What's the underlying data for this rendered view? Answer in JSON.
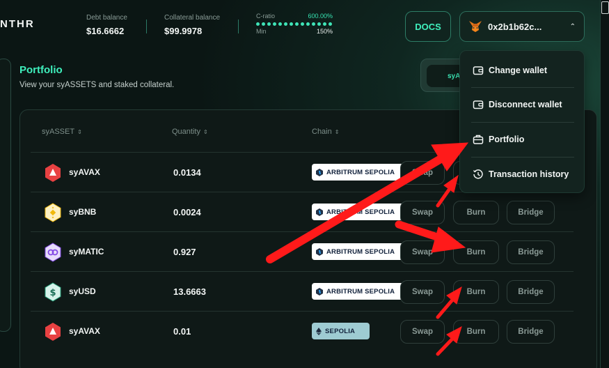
{
  "header": {
    "logo_text": "NTHR",
    "debt_label": "Debt balance",
    "debt_value": "$16.6662",
    "collateral_label": "Collateral balance",
    "collateral_value": "$99.9978",
    "cratio_label": "C-ratio",
    "cratio_value": "600.00%",
    "cratio_min_label": "Min",
    "cratio_min_value": "150%",
    "docs_label": "DOCS",
    "wallet_address": "0x2b1b62c...",
    "wallet_icon": "metamask-fox-icon"
  },
  "dropdown": {
    "items": [
      {
        "label": "Change wallet",
        "icon": "wallet-icon"
      },
      {
        "label": "Disconnect wallet",
        "icon": "wallet-icon"
      },
      {
        "label": "Portfolio",
        "icon": "briefcase-icon"
      },
      {
        "label": "Transaction history",
        "icon": "history-icon"
      }
    ]
  },
  "portfolio": {
    "title": "Portfolio",
    "subtitle": "View your syASSETS and staked collateral.",
    "toggle_label": "syA"
  },
  "table": {
    "columns": [
      "syASSET",
      "Quantity",
      "Chain"
    ],
    "rows": [
      {
        "asset": "syAVAX",
        "quantity": "0.0134",
        "chain": "ARBITRUM SEPOLIA",
        "icon": "avax-icon",
        "icon_color": "#e84142"
      },
      {
        "asset": "syBNB",
        "quantity": "0.0024",
        "chain": "ARBITRUM SEPOLIA",
        "icon": "bnb-icon",
        "icon_color": "#f0b90b"
      },
      {
        "asset": "syMATIC",
        "quantity": "0.927",
        "chain": "ARBITRUM SEPOLIA",
        "icon": "matic-icon",
        "icon_color": "#8247e5"
      },
      {
        "asset": "syUSD",
        "quantity": "13.6663",
        "chain": "ARBITRUM SEPOLIA",
        "icon": "usd-icon",
        "icon_color": "#26a17b"
      },
      {
        "asset": "syAVAX",
        "quantity": "0.01",
        "chain": "SEPOLIA",
        "icon": "avax-icon",
        "icon_color": "#e84142"
      }
    ],
    "actions": {
      "swap": "Swap",
      "burn": "Burn",
      "bridge": "Bridge"
    }
  },
  "colors": {
    "accent": "#3ff0bd",
    "annotation_arrow": "#ff1a1a",
    "background": "#0b1614"
  }
}
